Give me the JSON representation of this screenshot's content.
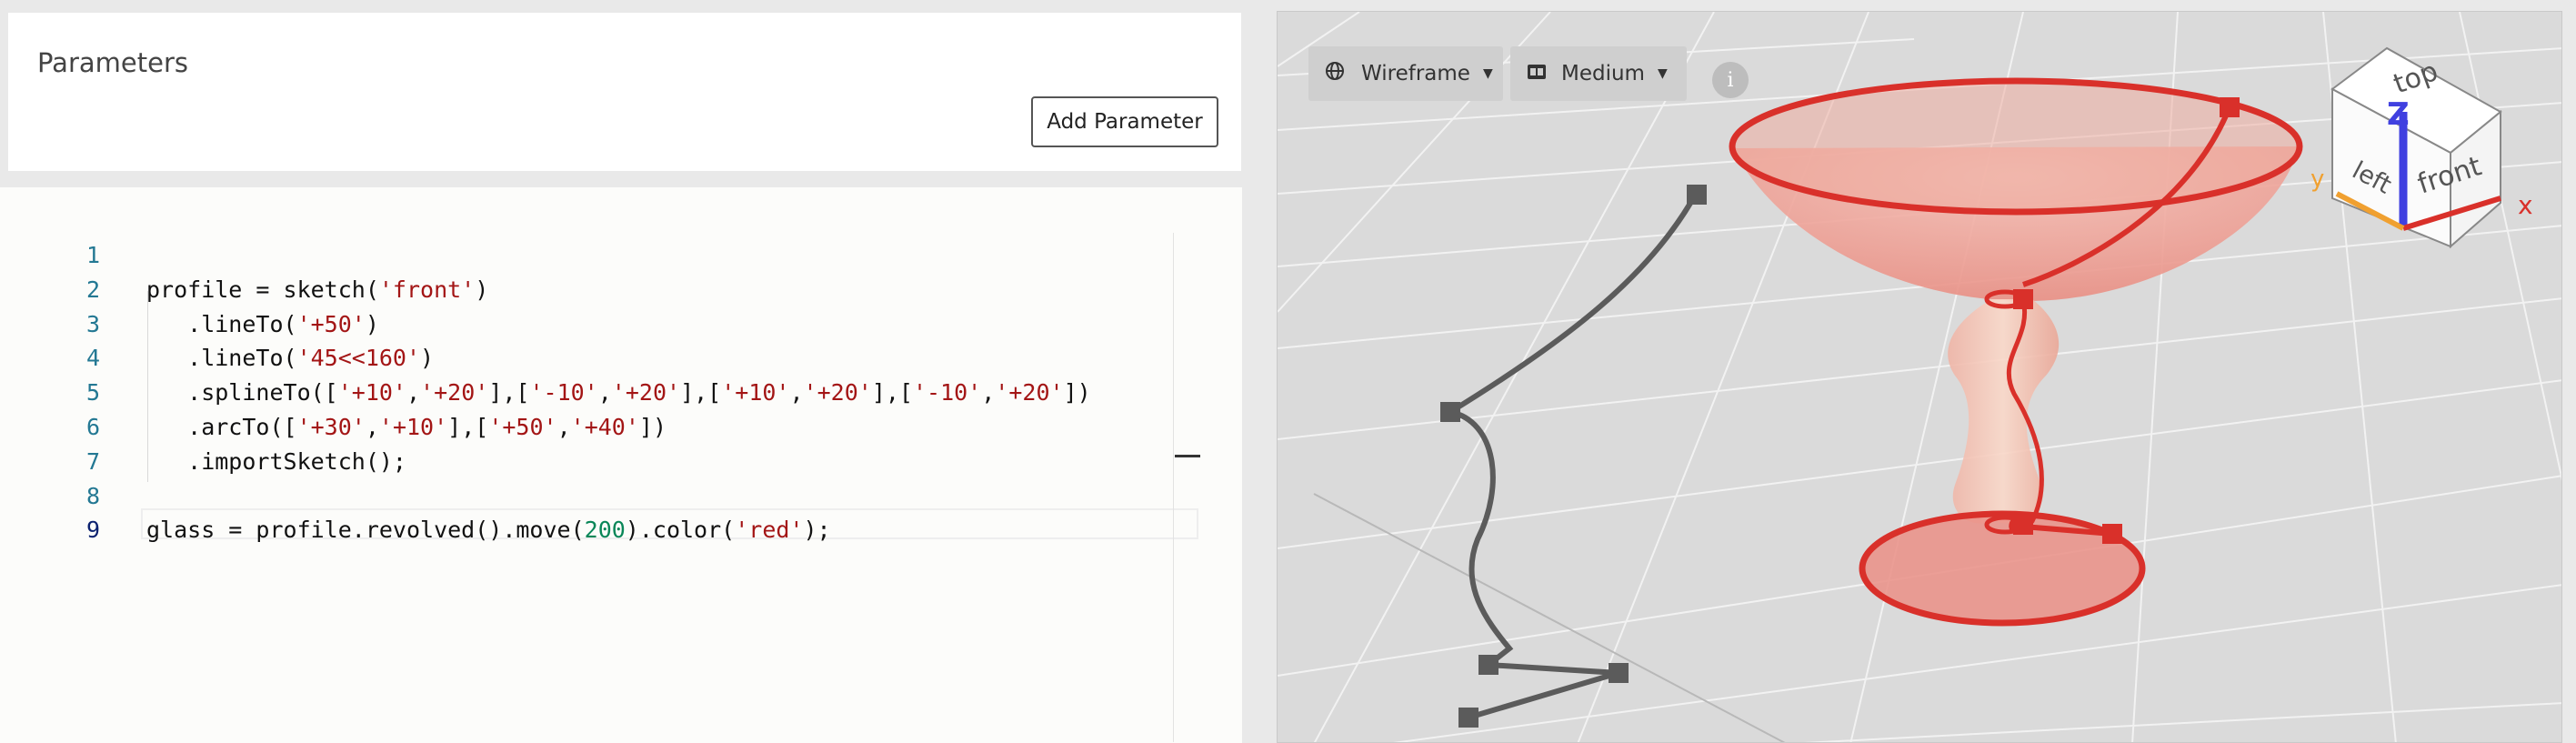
{
  "params": {
    "title": "Parameters",
    "add_button": "Add Parameter"
  },
  "editor": {
    "lines": [
      {
        "n": "1",
        "tokens": []
      },
      {
        "n": "2",
        "tokens": [
          {
            "t": "profile = sketch("
          },
          {
            "t": "'front'",
            "c": "str"
          },
          {
            "t": ")"
          }
        ]
      },
      {
        "n": "3",
        "tokens": [
          {
            "t": "   .lineTo("
          },
          {
            "t": "'+50'",
            "c": "str"
          },
          {
            "t": ")"
          }
        ]
      },
      {
        "n": "4",
        "tokens": [
          {
            "t": "   .lineTo("
          },
          {
            "t": "'45<<160'",
            "c": "str"
          },
          {
            "t": ")"
          }
        ]
      },
      {
        "n": "5",
        "tokens": [
          {
            "t": "   .splineTo(["
          },
          {
            "t": "'+10'",
            "c": "str"
          },
          {
            "t": ","
          },
          {
            "t": "'+20'",
            "c": "str"
          },
          {
            "t": "],["
          },
          {
            "t": "'-10'",
            "c": "str"
          },
          {
            "t": ","
          },
          {
            "t": "'+20'",
            "c": "str"
          },
          {
            "t": "],["
          },
          {
            "t": "'+10'",
            "c": "str"
          },
          {
            "t": ","
          },
          {
            "t": "'+20'",
            "c": "str"
          },
          {
            "t": "],["
          },
          {
            "t": "'-10'",
            "c": "str"
          },
          {
            "t": ","
          },
          {
            "t": "'+20'",
            "c": "str"
          },
          {
            "t": "])"
          }
        ]
      },
      {
        "n": "6",
        "tokens": [
          {
            "t": "   .arcTo(["
          },
          {
            "t": "'+30'",
            "c": "str"
          },
          {
            "t": ","
          },
          {
            "t": "'+10'",
            "c": "str"
          },
          {
            "t": "],["
          },
          {
            "t": "'+50'",
            "c": "str"
          },
          {
            "t": ","
          },
          {
            "t": "'+40'",
            "c": "str"
          },
          {
            "t": "])"
          }
        ]
      },
      {
        "n": "7",
        "tokens": [
          {
            "t": "   .importSketch();"
          }
        ]
      },
      {
        "n": "8",
        "tokens": []
      },
      {
        "n": "9",
        "tokens": [
          {
            "t": "glass = profile.revolved().move("
          },
          {
            "t": "200",
            "c": "num"
          },
          {
            "t": ").color("
          },
          {
            "t": "'red'",
            "c": "str"
          },
          {
            "t": ");"
          }
        ]
      }
    ],
    "current_line": "9"
  },
  "viewer": {
    "render_mode": "Wireframe",
    "quality": "Medium",
    "info_label": "i",
    "colors": {
      "model": "#d9302a",
      "sketch": "#5b5b5b",
      "axis_x": "#d9302a",
      "axis_y": "#f0a030",
      "axis_z": "#4040e0"
    },
    "view_cube": {
      "face_top": "top",
      "face_left": "left",
      "face_front": "front",
      "axis_x": "x",
      "axis_y": "y",
      "axis_z": "Z"
    }
  }
}
